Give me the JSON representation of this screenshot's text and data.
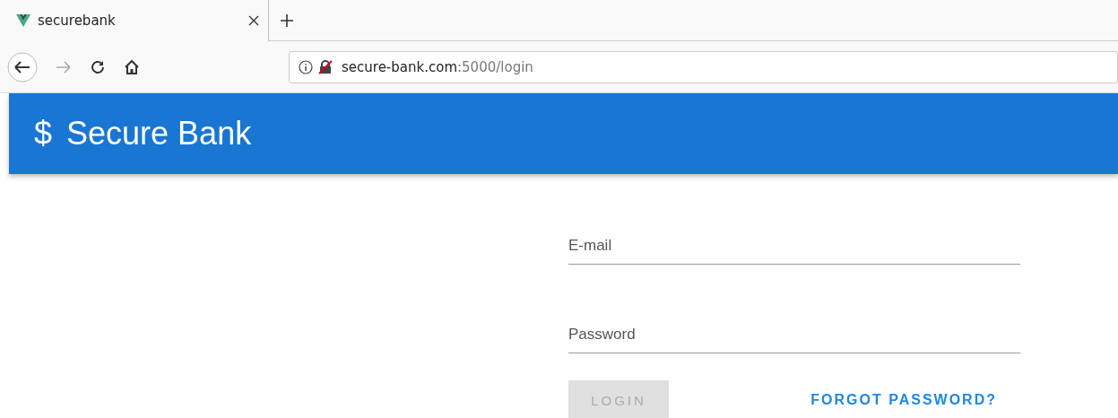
{
  "browser": {
    "tab": {
      "title": "securebank",
      "selected": true
    },
    "url": {
      "host": "secure-bank.com",
      "rest": ":5000/login"
    },
    "forward_disabled": true
  },
  "app_bar": {
    "icon": "$",
    "title": "Secure Bank"
  },
  "form": {
    "fields": [
      {
        "placeholder": "E-mail"
      },
      {
        "placeholder": "Password"
      }
    ],
    "login_button": {
      "label": "LOGIN",
      "disabled": true
    },
    "forgot_link": "FORGOT PASSWORD?"
  }
}
